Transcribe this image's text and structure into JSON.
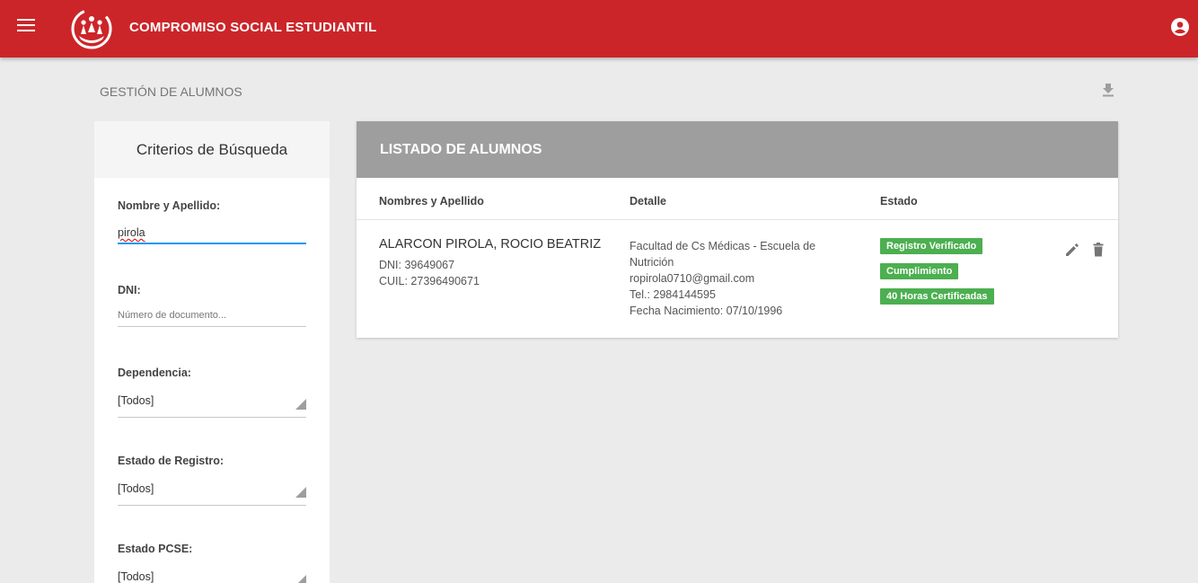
{
  "header": {
    "title": "COMPROMISO SOCIAL ESTUDIANTIL",
    "bar_color": "#cc2529"
  },
  "page": {
    "title": "GESTIÓN DE ALUMNOS"
  },
  "filters": {
    "title": "Criterios de Búsqueda",
    "name": {
      "label": "Nombre y Apellido:",
      "value": "pirola"
    },
    "dni": {
      "label": "DNI:",
      "placeholder": "Número de documento..."
    },
    "dependencia": {
      "label": "Dependencia:",
      "value": "[Todos]"
    },
    "estado_registro": {
      "label": "Estado de Registro:",
      "value": "[Todos]"
    },
    "estado_pcse": {
      "label": "Estado PCSE:",
      "value": "[Todos]"
    }
  },
  "list": {
    "title": "LISTADO DE ALUMNOS",
    "columns": [
      "Nombres y Apellido",
      "Detalle",
      "Estado"
    ],
    "rows": [
      {
        "name": "ALARCON PIROLA, ROCIO BEATRIZ",
        "dni": "DNI: 39649067",
        "cuil": "CUIL: 27396490671",
        "detail_line1": "Facultad de Cs Médicas - Escuela de",
        "detail_line2": "Nutrición",
        "email": "ropirola0710@gmail.com",
        "phone": "Tel.: 2984144595",
        "birth": "Fecha Nacimiento: 07/10/1996",
        "badges": [
          "Registro Verificado",
          "Cumplimiento",
          "40 Horas Certificadas"
        ],
        "badge_color": "#4caf50"
      }
    ]
  },
  "icons": {
    "menu": "menu-icon",
    "logo": "logo-icon",
    "user": "account-circle-icon",
    "download": "download-icon",
    "edit": "edit-icon",
    "delete": "delete-icon"
  }
}
